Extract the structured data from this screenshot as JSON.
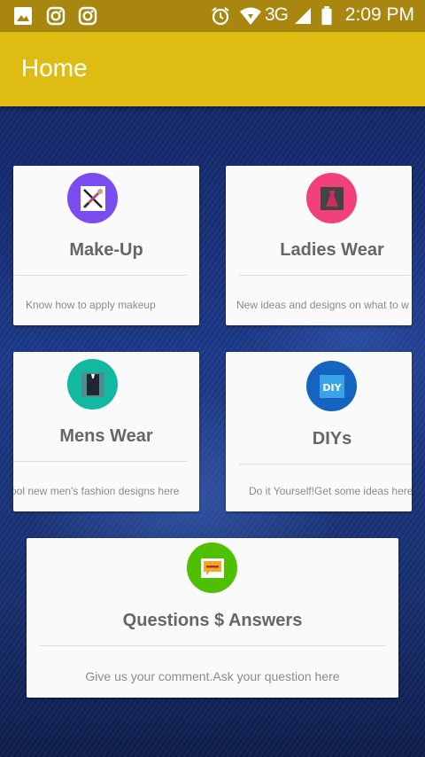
{
  "status_bar": {
    "network": "3G",
    "time": "2:09 PM",
    "icons": [
      "gallery-icon",
      "instagram-icon",
      "instagram-icon",
      "alarm-icon",
      "wifi-icon",
      "signal-icon",
      "battery-icon"
    ]
  },
  "app_bar": {
    "title": "Home",
    "color": "#dfbc13"
  },
  "cards": {
    "makeup": {
      "title": "Make-Up",
      "description": "Know how to apply makeup",
      "icon": "makeup-brush-icon",
      "circle_color": "#7b4df0"
    },
    "ladies": {
      "title": "Ladies Wear",
      "description": "New ideas and designs on what to w",
      "icon": "dress-icon",
      "circle_color": "#f2407a"
    },
    "mens": {
      "title": "Mens Wear",
      "description": "ool new men's fashion designs here",
      "icon": "suit-icon",
      "circle_color": "#12b8a0"
    },
    "diy": {
      "title": "DIYs",
      "description": "Do it Yourself!Get some ideas here",
      "icon": "diy-icon",
      "icon_text": "DIY",
      "circle_color": "#1565c0"
    },
    "qa": {
      "title": "Questions $ Answers",
      "description": "Give us your comment.Ask your question here",
      "icon": "chat-bubble-icon",
      "circle_color": "#4fc000"
    }
  }
}
